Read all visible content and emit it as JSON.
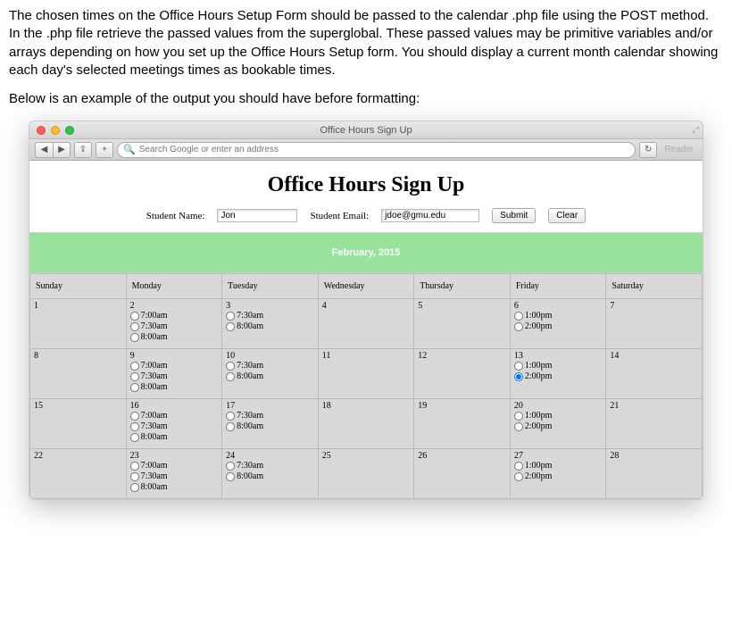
{
  "instructions": {
    "para1": "The chosen times on the Office Hours Setup Form should be passed to the calendar .php file using the POST method.  In the .php file retrieve the passed values from the superglobal.  These passed values may be primitive variables and/or arrays depending on how you set up the Office Hours Setup form.  You should display a current month calendar showing each day's selected meetings times as bookable times.",
    "para2": "Below is an example of the output you should have before formatting:"
  },
  "browser": {
    "window_title": "Office Hours Sign Up",
    "search_placeholder": "Search Google or enter an address",
    "reader_label": "Reader"
  },
  "page": {
    "heading": "Office Hours Sign Up",
    "student_name_label": "Student Name:",
    "student_name_value": "Jon",
    "student_email_label": "Student Email:",
    "student_email_value": "jdoe@gmu.edu",
    "submit_label": "Submit",
    "clear_label": "Clear",
    "month_label": "February, 2015",
    "weekdays": [
      "Sunday",
      "Monday",
      "Tuesday",
      "Wednesday",
      "Thursday",
      "Friday",
      "Saturday"
    ],
    "weeks": [
      [
        {
          "n": "1",
          "slots": []
        },
        {
          "n": "2",
          "slots": [
            "7:00am",
            "7:30am",
            "8:00am"
          ]
        },
        {
          "n": "3",
          "slots": [
            "7:30am",
            "8:00am"
          ]
        },
        {
          "n": "4",
          "slots": []
        },
        {
          "n": "5",
          "slots": []
        },
        {
          "n": "6",
          "slots": [
            "1:00pm",
            "2:00pm"
          ]
        },
        {
          "n": "7",
          "slots": []
        }
      ],
      [
        {
          "n": "8",
          "slots": []
        },
        {
          "n": "9",
          "slots": [
            "7:00am",
            "7:30am",
            "8:00am"
          ]
        },
        {
          "n": "10",
          "slots": [
            "7:30am",
            "8:00am"
          ]
        },
        {
          "n": "11",
          "slots": []
        },
        {
          "n": "12",
          "slots": []
        },
        {
          "n": "13",
          "slots": [
            "1:00pm",
            "2:00pm"
          ],
          "checked": "2:00pm"
        },
        {
          "n": "14",
          "slots": []
        }
      ],
      [
        {
          "n": "15",
          "slots": []
        },
        {
          "n": "16",
          "slots": [
            "7:00am",
            "7:30am",
            "8:00am"
          ]
        },
        {
          "n": "17",
          "slots": [
            "7:30am",
            "8:00am"
          ]
        },
        {
          "n": "18",
          "slots": []
        },
        {
          "n": "19",
          "slots": []
        },
        {
          "n": "20",
          "slots": [
            "1:00pm",
            "2:00pm"
          ]
        },
        {
          "n": "21",
          "slots": []
        }
      ],
      [
        {
          "n": "22",
          "slots": []
        },
        {
          "n": "23",
          "slots": [
            "7:00am",
            "7:30am",
            "8:00am"
          ]
        },
        {
          "n": "24",
          "slots": [
            "7:30am",
            "8:00am"
          ]
        },
        {
          "n": "25",
          "slots": []
        },
        {
          "n": "26",
          "slots": []
        },
        {
          "n": "27",
          "slots": [
            "1:00pm",
            "2:00pm"
          ]
        },
        {
          "n": "28",
          "slots": []
        }
      ]
    ]
  }
}
